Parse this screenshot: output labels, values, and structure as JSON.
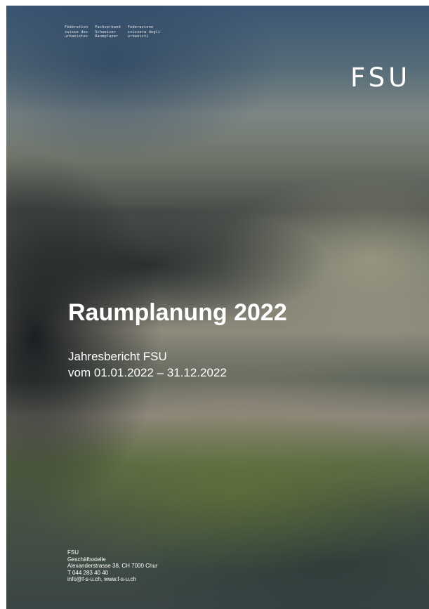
{
  "header": {
    "association_names": [
      "Fédération\nsuisse des\nurbanistes",
      "Fachverband\nSchweizer\nRaumplaner",
      "Federazione\nsvizzera degli\nurbanisti"
    ],
    "logo_text": "FSU"
  },
  "main": {
    "title": "Raumplanung 2022",
    "subtitle_line1": "Jahresbericht FSU",
    "subtitle_line2": "vom 01.01.2022 – 31.12.2022"
  },
  "footer": {
    "lines": [
      "FSU",
      "Geschäftsstelle",
      "Alexanderstrasse 38, CH 7000 Chur",
      "T 044 283 40 40",
      "info@f-s-u.ch, www.f-s-u.ch"
    ]
  },
  "colors": {
    "text": "#ffffff",
    "page_border": "#ffffff"
  }
}
